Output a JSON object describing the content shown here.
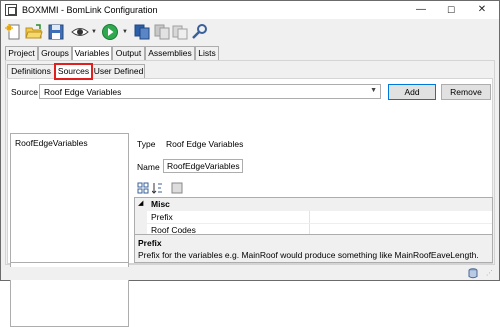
{
  "window": {
    "title": "BOXMMI - BomLink Configuration",
    "minimize": "—",
    "maximize": "☐",
    "close": "✕"
  },
  "toolbar": {
    "icons": [
      "new-icon",
      "open-folder-icon",
      "save-icon",
      "view-icon",
      "run-icon",
      "copy-icon",
      "paste-icon",
      "duplicate-icon",
      "settings-wrench-icon"
    ]
  },
  "tabs": [
    "Project",
    "Groups",
    "Variables",
    "Output",
    "Assemblies",
    "Lists"
  ],
  "active_tab": "Variables",
  "subtabs": [
    "Definitions",
    "Sources",
    "User Defined"
  ],
  "active_subtab": "Sources",
  "source": {
    "label": "Source",
    "selected": "Roof Edge Variables",
    "add_label": "Add",
    "remove_label": "Remove"
  },
  "list": {
    "items": [
      "RoofEdgeVariables"
    ]
  },
  "details": {
    "type_label": "Type",
    "type_value": "Roof Edge Variables",
    "name_label": "Name",
    "name_value": "RoofEdgeVariables"
  },
  "property_grid": {
    "category": "Misc",
    "rows": [
      {
        "name": "Prefix",
        "value": ""
      },
      {
        "name": "Roof Codes",
        "value": ""
      }
    ],
    "help_title": "Prefix",
    "help_text": "Prefix for the variables e.g. MainRoof would produce something like MainRoofEaveLength."
  },
  "colors": {
    "highlight": "#e0201e",
    "accent": "#0078d7"
  }
}
